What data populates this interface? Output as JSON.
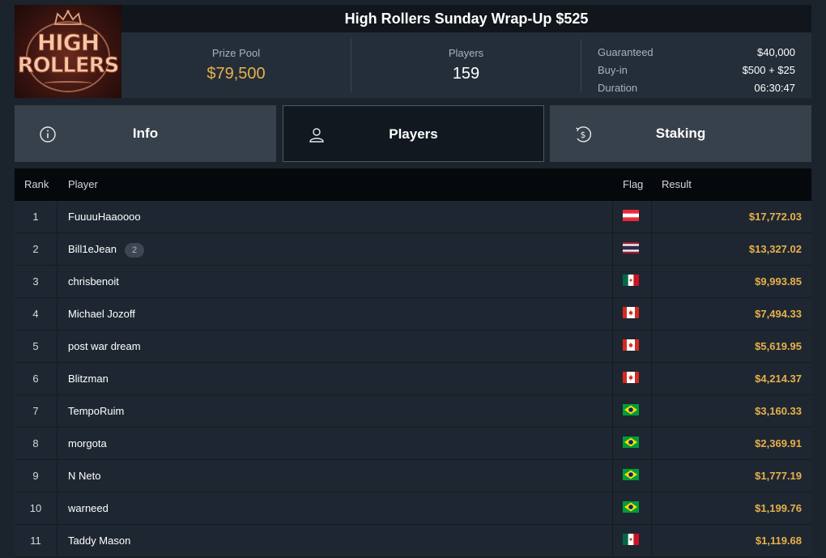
{
  "header": {
    "title": "High Rollers Sunday Wrap-Up $525",
    "logo_line1": "HIGH",
    "logo_line2": "ROLLERS",
    "prize_pool_label": "Prize Pool",
    "prize_pool_value": "$79,500",
    "players_label": "Players",
    "players_value": "159",
    "details": [
      {
        "label": "Guaranteed",
        "value": "$40,000"
      },
      {
        "label": "Buy-in",
        "value": "$500 + $25"
      },
      {
        "label": "Duration",
        "value": "06:30:47"
      }
    ]
  },
  "tabs": [
    {
      "label": "Info",
      "icon": "info-icon",
      "active": false
    },
    {
      "label": "Players",
      "icon": "user-icon",
      "active": true
    },
    {
      "label": "Staking",
      "icon": "dollar-icon",
      "active": false
    }
  ],
  "table": {
    "columns": [
      "Rank",
      "Player",
      "Flag",
      "Result"
    ],
    "rows": [
      {
        "rank": "1",
        "player": "FuuuuHaaoooo",
        "flag": "austria",
        "result": "$17,772.03"
      },
      {
        "rank": "2",
        "player": "Bill1eJean",
        "badge": "2",
        "flag": "thailand",
        "result": "$13,327.02"
      },
      {
        "rank": "3",
        "player": "chrisbenoit",
        "flag": "mexico",
        "result": "$9,993.85"
      },
      {
        "rank": "4",
        "player": "Michael Jozoff",
        "flag": "canada",
        "result": "$7,494.33"
      },
      {
        "rank": "5",
        "player": "post war dream",
        "flag": "canada",
        "result": "$5,619.95"
      },
      {
        "rank": "6",
        "player": "Blitzman",
        "flag": "canada",
        "result": "$4,214.37"
      },
      {
        "rank": "7",
        "player": "TempoRuim",
        "flag": "brazil",
        "result": "$3,160.33"
      },
      {
        "rank": "8",
        "player": "morgota",
        "flag": "brazil",
        "result": "$2,369.91"
      },
      {
        "rank": "9",
        "player": "N Neto",
        "flag": "brazil",
        "result": "$1,777.19"
      },
      {
        "rank": "10",
        "player": "warneed",
        "flag": "brazil",
        "result": "$1,199.76"
      },
      {
        "rank": "11",
        "player": "Taddy Mason",
        "flag": "mexico",
        "result": "$1,119.68"
      }
    ]
  },
  "colors": {
    "accent_gold": "#e8b04a",
    "background": "#1b232c",
    "active_tab": "#11181f",
    "inactive_tab": "#37414c"
  }
}
